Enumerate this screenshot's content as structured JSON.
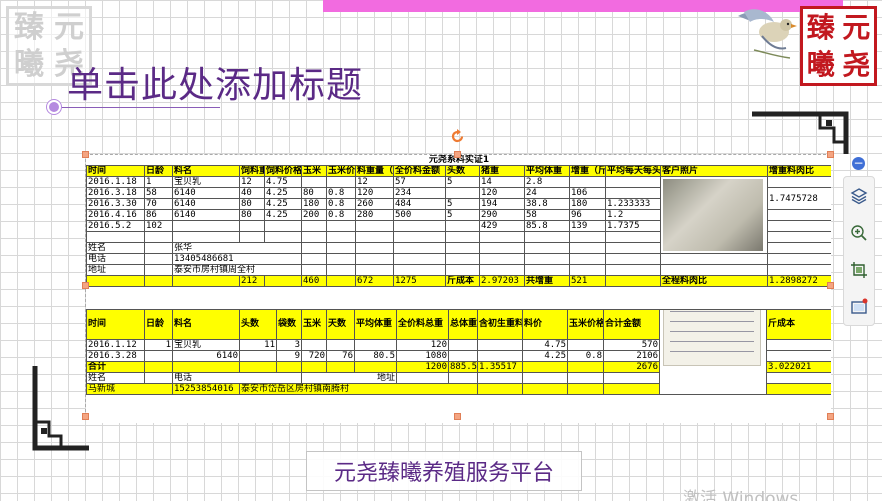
{
  "slide": {
    "title_placeholder": "单击此处添加标题",
    "footer_text": "元尧臻曦养殖服务平台",
    "logo_chars": [
      "臻",
      "元",
      "曦",
      "尧"
    ],
    "accent_color": "#f26be0",
    "title_color": "#5b2a86",
    "logo_red": "#c2181f"
  },
  "os": {
    "activation_watermark": "激活 Windows"
  },
  "sheet": {
    "caption": "元尧系料实证1",
    "t1_headers": [
      "时间",
      "日龄",
      "料名",
      "饲料重量",
      "饲料价格",
      "玉米",
      "玉米价格",
      "料重量（斤）",
      "全价料金额（元）",
      "头数",
      "猪重",
      "平均体重",
      "增重（斤）",
      "平均每天每头增重",
      "客户照片",
      "增重料肉比"
    ],
    "t1_rows": [
      [
        "2016.1.18",
        "1",
        "宝贝乳",
        "12",
        "4.75",
        "",
        "",
        "12",
        "57",
        "5",
        "14",
        "2.8",
        "",
        "",
        "",
        ""
      ],
      [
        "2016.3.18",
        "58",
        "6140",
        "40",
        "4.25",
        "80",
        "0.8",
        "120",
        "234",
        "",
        "120",
        "24",
        "106",
        "",
        "",
        "1.7475728"
      ],
      [
        "2016.3.30",
        "70",
        "6140",
        "80",
        "4.25",
        "180",
        "0.8",
        "260",
        "484",
        "5",
        "194",
        "38.8",
        "180",
        "1.233333",
        "",
        ""
      ],
      [
        "2016.4.16",
        "86",
        "6140",
        "80",
        "4.25",
        "200",
        "0.8",
        "280",
        "500",
        "5",
        "290",
        "58",
        "96",
        "1.2",
        "",
        ""
      ],
      [
        "2016.5.2",
        "102",
        "",
        "",
        "",
        "",
        "",
        "",
        "",
        "",
        "429",
        "85.8",
        "139",
        "1.7375",
        "",
        ""
      ]
    ],
    "t1_info": {
      "name_label": "姓名",
      "name_value": "张华",
      "phone_label": "电话",
      "phone_value": "13405486681",
      "addr_label": "地址",
      "addr_value": "泰安市房村镇周全村"
    },
    "t1_totals": {
      "feed_weight": "212",
      "corn": "460",
      "material_weight": "672",
      "amount": "1275",
      "cost_label": "斤成本",
      "cost_value": "2.97203",
      "gain_label": "共增重",
      "gain_value": "521",
      "ratio_label": "全程料肉比",
      "ratio_value": "1.2898272"
    },
    "t2_headers": [
      "时间",
      "日龄",
      "料名",
      "头数",
      "袋数",
      "玉米",
      "天数",
      "平均体重",
      "全价料总重",
      "总体重",
      "含初生重料肉比",
      "料价",
      "玉米价格",
      "合计金额",
      "",
      "斤成本"
    ],
    "t2_rows": [
      [
        "2016.1.12",
        "1",
        "宝贝乳",
        "11",
        "3",
        "",
        "",
        "",
        "120",
        "",
        "",
        "4.75",
        "",
        "570",
        "",
        ""
      ],
      [
        "2016.3.28",
        "",
        "6140",
        "",
        "9",
        "720",
        "76",
        "80.5",
        "1080",
        "",
        "",
        "4.25",
        "0.8",
        "2106",
        "",
        ""
      ]
    ],
    "t2_total": {
      "label": "合计",
      "total_weight": "1200",
      "body_weight": "885.5",
      "ratio": "1.35517",
      "amount": "2676",
      "cost": "3.022021"
    },
    "t2_info": {
      "name_label": "姓名",
      "phone_label": "电话",
      "addr_label": "地址",
      "name_value": "马新城",
      "phone_value": "15253854016",
      "addr_value": "泰安市岱岳区房村镇南腾村"
    }
  }
}
